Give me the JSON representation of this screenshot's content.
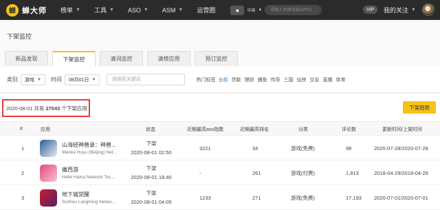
{
  "brand": {
    "logo_mark": "蝉",
    "name": "蝉大师"
  },
  "nav": [
    {
      "label": "榜单",
      "has_dropdown": true
    },
    {
      "label": "工具",
      "has_dropdown": true
    },
    {
      "label": "ASO",
      "has_dropdown": true
    },
    {
      "label": "ASM",
      "has_dropdown": true
    },
    {
      "label": "运营圈",
      "has_dropdown": false
    }
  ],
  "store": {
    "icon": "apple-icon",
    "glyph": "",
    "country": "中国",
    "search_placeholder": "请输入关键词或APPID"
  },
  "user": {
    "vip_label": "VIP",
    "follow_label": "我的关注"
  },
  "page": {
    "title": "下架监控"
  },
  "tabs": [
    {
      "label": "新品发现",
      "active": false
    },
    {
      "label": "下架监控",
      "active": true
    },
    {
      "label": "清词监控",
      "active": false
    },
    {
      "label": "清榜应用",
      "active": false
    },
    {
      "label": "预订监控",
      "active": false
    }
  ],
  "filters": {
    "category_label": "类别",
    "category_value": "游戏",
    "time_label": "时间",
    "time_value": "08月01日",
    "keyword_placeholder": "请搜索关键词",
    "hot_label": "热门标签",
    "hot_tags": [
      "全部",
      "贷款",
      "理财",
      "捕鱼",
      "传奇",
      "三国",
      "仙侠",
      "交友",
      "直播",
      "体育"
    ]
  },
  "summary": {
    "date": "2020-08-01",
    "prefix": "共有",
    "count": "27043",
    "suffix": "个下架应用"
  },
  "trend_button": "下架趋势",
  "columns": [
    "#",
    "应用",
    "状态",
    "近期最高aso指数",
    "近期最高排名",
    "分类",
    "评论数",
    "更新时间/上架时间"
  ],
  "rows": [
    {
      "rank": "1",
      "name": "山海经神兽录：神兽...",
      "developer": "Wanke Huyu (Beijing) Net...",
      "status": "下架",
      "status_time": "2020-08-01 02:50",
      "aso": "3221",
      "best_rank": "34",
      "category": "游戏(免费)",
      "reviews": "98",
      "dates": "2020-07-28/2020-07-28",
      "icon_colors": [
        "#2a5d8f",
        "#e8eef5"
      ]
    },
    {
      "rank": "2",
      "name": "痛西游",
      "developer": "Hefei Haina Network Tec...",
      "status": "下架",
      "status_time": "2020-08-01 18:40",
      "aso": "-",
      "best_rank": "261",
      "category": "游戏(付费)",
      "reviews": "1,813",
      "dates": "2018-04-29/2018-04-29",
      "icon_colors": [
        "#e04a7a",
        "#f7c3d2"
      ]
    },
    {
      "rank": "3",
      "name": "地下城觉醒",
      "developer": "Suzhou Langming Netwo...",
      "status": "下架",
      "status_time": "2020-08-01 04:05",
      "aso": "1233",
      "best_rank": "271",
      "category": "游戏(免费)",
      "reviews": "17,193",
      "dates": "2020-07-01/2020-07-01",
      "icon_colors": [
        "#c8202a",
        "#5a1a6a"
      ]
    }
  ]
}
